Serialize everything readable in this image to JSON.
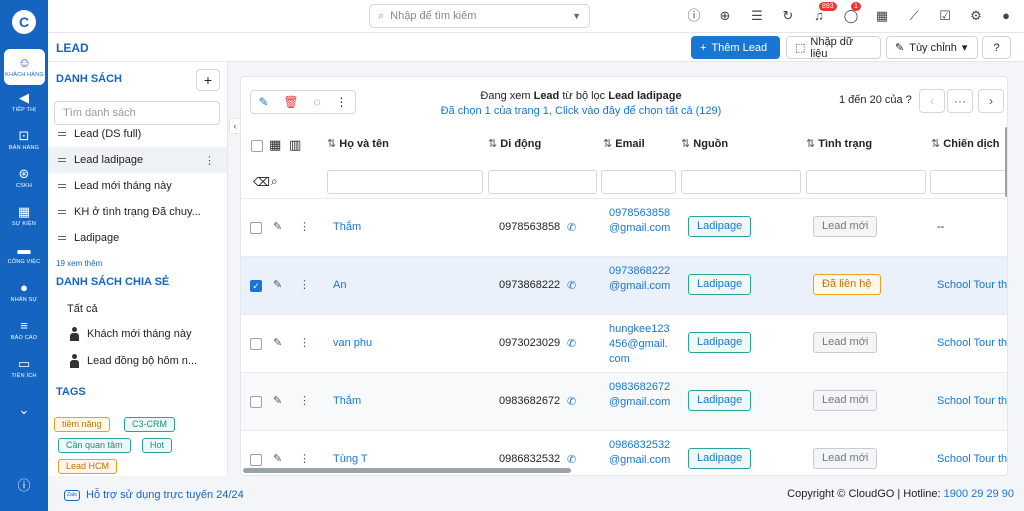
{
  "sidebar": {
    "logo": "C",
    "items": [
      {
        "label": "KHÁCH HÀNG",
        "icon": "users-icon",
        "glyph": "☺"
      },
      {
        "label": "TIẾP THỊ",
        "icon": "megaphone-icon",
        "glyph": "◀"
      },
      {
        "label": "BÁN HÀNG",
        "icon": "cart-icon",
        "glyph": "⊡"
      },
      {
        "label": "CSKH",
        "icon": "lifebuoy-icon",
        "glyph": "⊛"
      },
      {
        "label": "SỰ KIỆN",
        "icon": "calendar-icon",
        "glyph": "▦"
      },
      {
        "label": "CÔNG VIỆC",
        "icon": "briefcase-icon",
        "glyph": "▬"
      },
      {
        "label": "NHÂN SỰ",
        "icon": "person-icon",
        "glyph": "●"
      },
      {
        "label": "BÁO CÁO",
        "icon": "report-icon",
        "glyph": "≡"
      },
      {
        "label": "TIỆN ÍCH",
        "icon": "toolbox-icon",
        "glyph": "▭"
      }
    ],
    "expand_glyph": "⌄",
    "info_glyph": "ⓘ"
  },
  "topbar": {
    "search_placeholder": "Nhập để tìm kiếm",
    "notif_count": "893",
    "chat_count": "1"
  },
  "subbar": {
    "title": "LEAD",
    "add_label": "Thêm Lead",
    "import_label": "Nhập dữ liệu",
    "customize_label": "Tùy chỉnh",
    "help_glyph": "?"
  },
  "lists": {
    "title": "DANH SÁCH",
    "search_placeholder": "Tìm danh sách",
    "items": [
      "Lead (DS full)",
      "Lead ladipage",
      "Lead mới tháng này",
      "KH ở tình trạng Đã chuy...",
      "Ladipage"
    ],
    "see_more": "19 xem thêm",
    "shared_title": "DANH SÁCH CHIA SẺ",
    "shared_all": "Tất cả",
    "shared_items": [
      "Khách mới tháng này",
      "Lead đồng bộ hôm n..."
    ],
    "tags_title": "TAGS",
    "tags": [
      {
        "label": "tiềm năng",
        "color": "#f0a020"
      },
      {
        "label": "C3-CRM",
        "color": "#26a69a"
      },
      {
        "label": "Cần quan tâm",
        "color": "#26a69a"
      },
      {
        "label": "Hot",
        "color": "#26a69a"
      },
      {
        "label": "Lead HCM",
        "color": "#f0a020"
      }
    ]
  },
  "main": {
    "info_prefix": "Đang xem",
    "info_module": "Lead",
    "info_middle": "từ bộ lọc",
    "info_filter": "Lead ladipage",
    "info_select": "Đã chọn 1 của trang 1, Click vào đây để chọn tất cả (129)",
    "pager": "1 đến 20 của ?",
    "columns": [
      "Họ và tên",
      "Di động",
      "Email",
      "Nguồn",
      "Tình trạng",
      "Chiến dịch"
    ],
    "rows": [
      {
        "name": "Thắm",
        "phone": "0978563858",
        "email": "0978563858@gmail.com",
        "source": "Ladipage",
        "status": "Lead mới",
        "campaign": "--",
        "checked": false
      },
      {
        "name": "An",
        "phone": "0973868222",
        "email": "0973868222@gmail.com",
        "source": "Ladipage",
        "status": "Đã liên hệ",
        "campaign": "School Tour thá",
        "checked": true
      },
      {
        "name": "van phu",
        "phone": "0973023029",
        "email": "hungkee123456@gmail.com",
        "source": "Ladipage",
        "status": "Lead mới",
        "campaign": "School Tour thá",
        "checked": false
      },
      {
        "name": "Thắm",
        "phone": "0983682672",
        "email": "0983682672@gmail.com",
        "source": "Ladipage",
        "status": "Lead mới",
        "campaign": "School Tour thá",
        "checked": false
      },
      {
        "name": "Tùng T",
        "phone": "0986832532",
        "email": "0986832532@gmail.com",
        "source": "Ladipage",
        "status": "Lead mới",
        "campaign": "School Tour thá",
        "checked": false
      }
    ]
  },
  "footer": {
    "zalo": "Zalo",
    "support": "Hỗ trợ sử dụng trực tuyến 24/24",
    "copyright": "Copyright © CloudGO | Hotline:",
    "hotline": "1900 29 29 90"
  }
}
